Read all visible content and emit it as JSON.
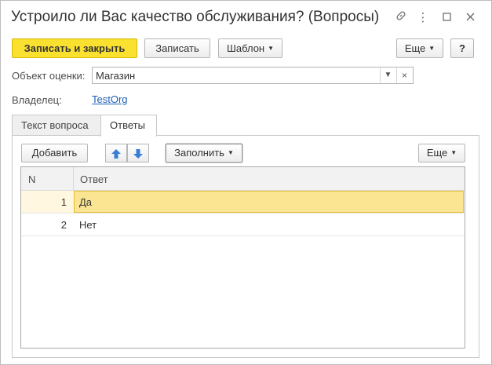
{
  "window": {
    "title": "Устроило ли Вас качество обслуживания? (Вопросы)",
    "controls": {
      "link_icon": "link-icon",
      "menu_icon": "more-vertical-icon",
      "maximize_icon": "maximize-icon",
      "close_icon": "close-icon"
    }
  },
  "toolbar": {
    "save_close_label": "Записать и закрыть",
    "save_label": "Записать",
    "template_label": "Шаблон",
    "more_label": "Еще",
    "help_label": "?"
  },
  "form": {
    "object_label": "Объект оценки:",
    "object_value": "Магазин",
    "owner_label": "Владелец:",
    "owner_value": "TestOrg"
  },
  "tabs": [
    {
      "label": "Текст вопроса",
      "active": false
    },
    {
      "label": "Ответы",
      "active": true
    }
  ],
  "answers_toolbar": {
    "add_label": "Добавить",
    "fill_label": "Заполнить",
    "more_label": "Еще"
  },
  "table": {
    "columns": [
      "N",
      "Ответ"
    ],
    "rows": [
      {
        "n": "1",
        "answer": "Да",
        "selected": true
      },
      {
        "n": "2",
        "answer": "Нет",
        "selected": false
      }
    ]
  },
  "colors": {
    "primary_button": "#fbe12f",
    "selected_row": "#fbe593",
    "link": "#1d5db8",
    "arrow": "#3a7fd5"
  }
}
